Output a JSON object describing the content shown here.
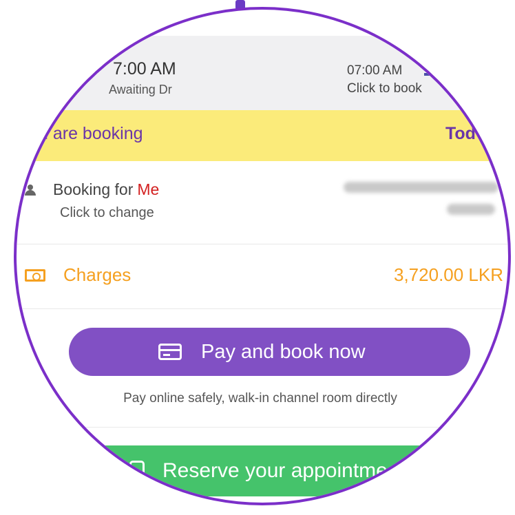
{
  "time_slots": [
    {
      "time": "7:00 AM",
      "status": "Awaiting Dr"
    },
    {
      "time": "07:00 AM",
      "status": "Click to book"
    }
  ],
  "booking_banner": {
    "left_text": "u are booking",
    "right_text": "Tod"
  },
  "booking_for": {
    "label": "Booking for",
    "value": "Me",
    "hint": "Click to change"
  },
  "charges": {
    "label": "Charges",
    "amount": "3,720.00 LKR"
  },
  "pay_button": {
    "label": "Pay and book now",
    "note": "Pay online safely, walk-in channel room directly"
  },
  "reserve_button": {
    "label": "Reserve your appointme"
  },
  "colors": {
    "accent_purple": "#8150c4",
    "banner_yellow": "#fbeb7a",
    "charges_orange": "#f5a020",
    "reserve_green": "#45c36b",
    "highlight_red": "#d32020",
    "lens_border": "#7b2fc9"
  },
  "icons": [
    "calendar-icon",
    "person-icon",
    "money-icon",
    "credit-card-icon",
    "clock-icon"
  ]
}
